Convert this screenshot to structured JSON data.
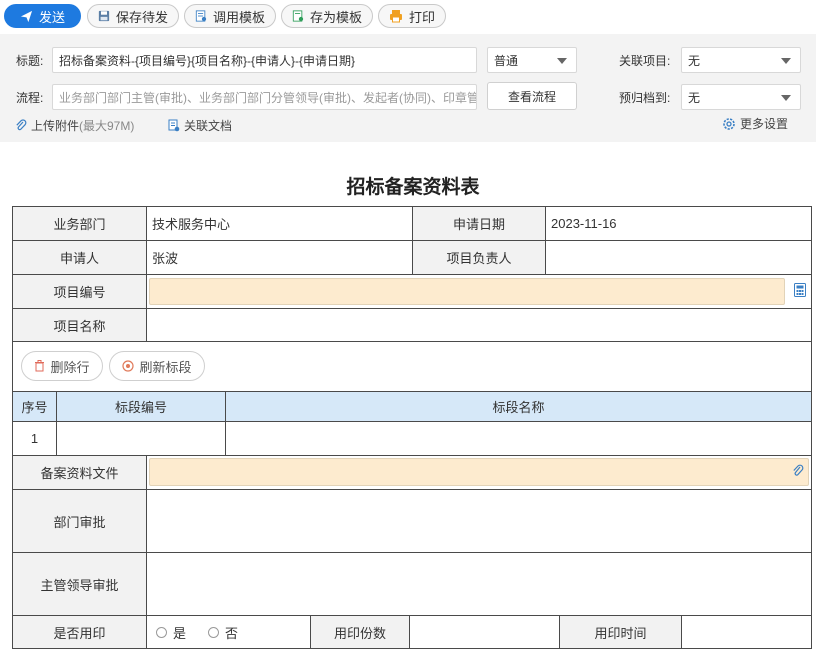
{
  "toolbar": {
    "send": "发送",
    "save_draft": "保存待发",
    "load_template": "调用模板",
    "save_template": "存为模板",
    "print": "打印"
  },
  "header": {
    "title_label": "标题:",
    "title_value": "招标备案资料-{项目编号}{项目名称}-{申请人}-{申请日期}",
    "priority_value": "普通",
    "related_project_label": "关联项目:",
    "related_project_value": "无",
    "flow_label": "流程:",
    "flow_value": "业务部门部门主管(审批)、业务部门部门分管领导(审批)、发起者(协同)、印章管",
    "view_flow_button": "查看流程",
    "archive_label": "预归档到:",
    "archive_value": "无",
    "upload_label": "上传附件",
    "upload_hint": "(最大97M)",
    "related_doc_label": "关联文档",
    "more_settings": "更多设置"
  },
  "form": {
    "title": "招标备案资料表",
    "dept_label": "业务部门",
    "dept_value": "技术服务中心",
    "apply_date_label": "申请日期",
    "apply_date_value": "2023-11-16",
    "applicant_label": "申请人",
    "applicant_value": "张波",
    "pm_label": "项目负责人",
    "pm_value": "",
    "project_no_label": "项目编号",
    "project_name_label": "项目名称",
    "delete_row": "删除行",
    "refresh_section": "刷新标段",
    "col_seq": "序号",
    "col_section_no": "标段编号",
    "col_section_name": "标段名称",
    "rows": [
      {
        "seq": "1",
        "section_no": "",
        "section_name": ""
      }
    ],
    "file_label": "备案资料文件",
    "dept_approval_label": "部门审批",
    "leader_approval_label": "主管领导审批",
    "use_seal_label": "是否用印",
    "yes": "是",
    "no": "否",
    "seal_copies_label": "用印份数",
    "seal_time_label": "用印时间"
  },
  "colors": {
    "primary": "#1e7ae0",
    "field_highlight": "#fdebcf",
    "table_header_blue": "#d6e8f8"
  }
}
